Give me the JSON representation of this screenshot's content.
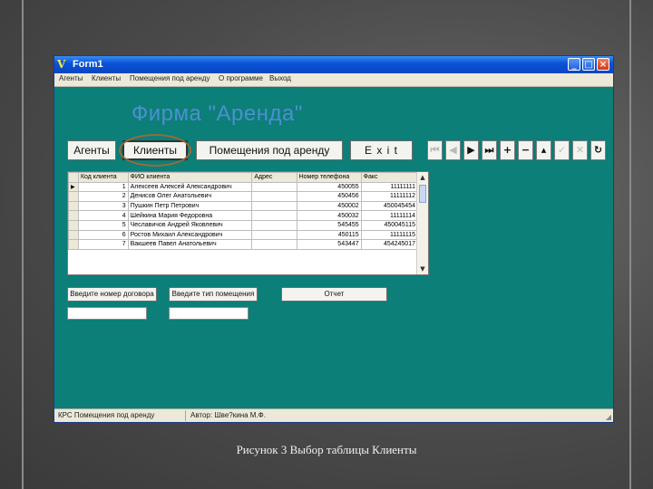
{
  "window": {
    "title": "Form1",
    "icon": "app-logo-icon",
    "controls": {
      "minimize": "_",
      "maximize": "□",
      "close": "×"
    }
  },
  "menu": [
    "Агенты",
    "Клиенты",
    "Помещения под аренду",
    "О программе",
    "Выход"
  ],
  "heading": "Фирма \"Аренда\"",
  "nav_buttons": {
    "agents": "Агенты",
    "clients": "Клиенты",
    "premises": "Помещения под аренду",
    "exit": "E x i t"
  },
  "navigator": {
    "icons": [
      "first-record-icon",
      "prior-record-icon",
      "next-record-icon",
      "last-record-icon",
      "insert-icon",
      "delete-icon",
      "edit-icon",
      "post-icon",
      "cancel-icon",
      "refresh-icon"
    ],
    "glyphs": [
      "⏮",
      "◀",
      "▶",
      "⏭",
      "+",
      "−",
      "▴",
      "✓",
      "✕",
      "↻"
    ],
    "disabled": [
      true,
      true,
      false,
      false,
      false,
      false,
      false,
      true,
      true,
      false
    ]
  },
  "grid": {
    "columns": [
      "Код клиента",
      "ФИО клиента",
      "Адрес",
      "Номер телефона",
      "Факс"
    ],
    "rows": [
      [
        "1",
        "Алексеев Алексей Александрович",
        "",
        "450055",
        "11111111"
      ],
      [
        "2",
        "Денисов Олег Анатольевич",
        "",
        "450456",
        "11111112"
      ],
      [
        "3",
        "Пушкин Петр Петрович",
        "",
        "450002",
        "450045454"
      ],
      [
        "4",
        "Шейкина Мария Федоровна",
        "",
        "450032",
        "11111114"
      ],
      [
        "5",
        "Чеславичов Андрей Яковлевич",
        "",
        "545455",
        "450045115"
      ],
      [
        "6",
        "Ростов Михаил Александрович",
        "",
        "450115",
        "11111115"
      ],
      [
        "7",
        "Вакшеев Павел Анатольевич",
        "",
        "543447",
        "454245017"
      ]
    ],
    "current_row": 0
  },
  "form": {
    "contract_button": "Введите номер договора",
    "premises_type_button": "Введите тип помещения",
    "report_button": "Отчет",
    "contract_value": "",
    "premises_type_value": ""
  },
  "status": {
    "left": "КРС Помещения под аренду",
    "right": "Автор: Шве?кина М.Ф."
  },
  "caption": "Рисунок 3 Выбор таблицы Клиенты",
  "colors": {
    "form_background": "#0b7f78",
    "heading": "#4d8fd0",
    "titlebar": "#0a55d8",
    "highlight_ring": "#9a6a38"
  }
}
